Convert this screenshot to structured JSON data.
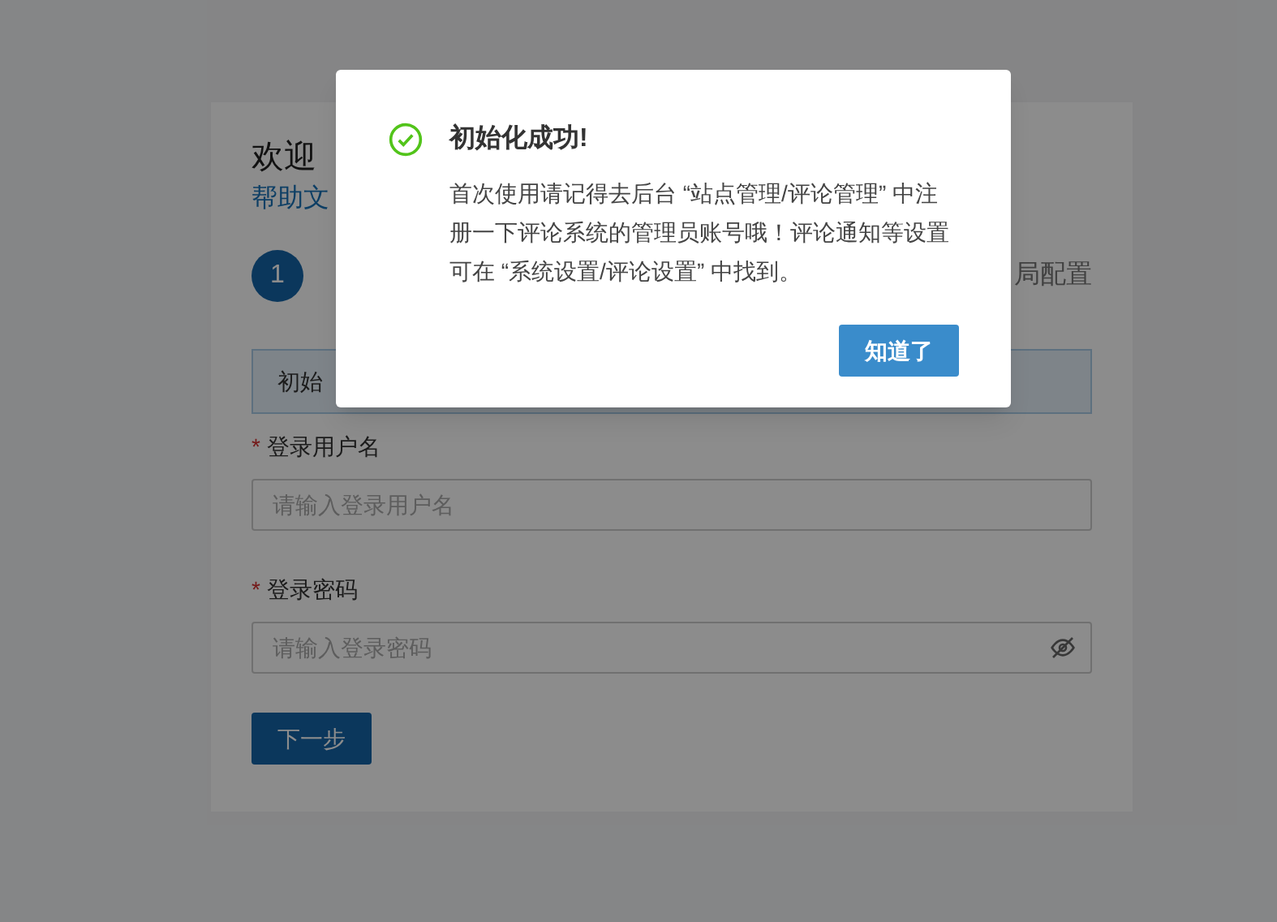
{
  "page": {
    "title": "欢迎",
    "help_link": "帮助文",
    "steps": [
      {
        "number": "1",
        "selected": true
      },
      {
        "label": "局配置",
        "selected": false
      }
    ],
    "alert": "初始",
    "fields": [
      {
        "label": "登录用户名",
        "required_mark": "*",
        "placeholder": "请输入登录用户名",
        "kind": "text"
      },
      {
        "label": "登录密码",
        "required_mark": "*",
        "placeholder": "请输入登录密码",
        "kind": "password"
      }
    ],
    "next_button": "下一步"
  },
  "dialog": {
    "title": "初始化成功!",
    "message": "首次使用请记得去后台 “站点管理/评论管理” 中注册一下评论系统的管理员账号哦！评论通知等设置可在 “系统设置/评论设置” 中找到。",
    "button": "知道了"
  }
}
